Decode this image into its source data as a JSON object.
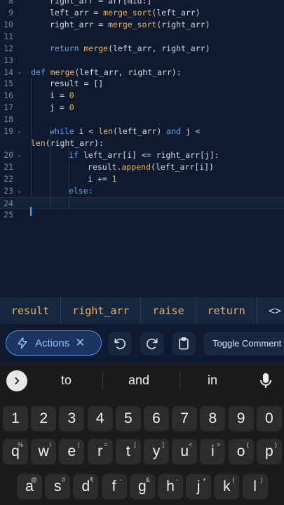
{
  "editor": {
    "lines": [
      {
        "num": "8",
        "indent": 1,
        "fold": false,
        "tokens": [
          {
            "t": "right_arr = arr[mid:]"
          }
        ]
      },
      {
        "num": "9",
        "indent": 1,
        "fold": false,
        "tokens": [
          {
            "t": "left_arr = "
          },
          {
            "t": "merge_sort",
            "c": "fn"
          },
          {
            "t": "(left_arr)"
          }
        ]
      },
      {
        "num": "10",
        "indent": 1,
        "fold": false,
        "tokens": [
          {
            "t": "right_arr = "
          },
          {
            "t": "merge_sort",
            "c": "fn"
          },
          {
            "t": "(right_arr)"
          }
        ]
      },
      {
        "num": "11",
        "indent": 0,
        "fold": false,
        "tokens": []
      },
      {
        "num": "12",
        "indent": 1,
        "fold": false,
        "tokens": [
          {
            "t": "return ",
            "c": "kw"
          },
          {
            "t": "merge",
            "c": "fn"
          },
          {
            "t": "(left_arr, right_arr)"
          }
        ]
      },
      {
        "num": "13",
        "indent": 0,
        "fold": false,
        "tokens": []
      },
      {
        "num": "14",
        "indent": 0,
        "fold": true,
        "tokens": [
          {
            "t": "def ",
            "c": "kw"
          },
          {
            "t": "merge",
            "c": "fn"
          },
          {
            "t": "(left_arr, right_arr):"
          }
        ]
      },
      {
        "num": "15",
        "indent": 1,
        "fold": false,
        "tokens": [
          {
            "t": "result = []"
          }
        ]
      },
      {
        "num": "16",
        "indent": 1,
        "fold": false,
        "tokens": [
          {
            "t": "i = "
          },
          {
            "t": "0",
            "c": "num"
          }
        ]
      },
      {
        "num": "17",
        "indent": 1,
        "fold": false,
        "tokens": [
          {
            "t": "j = "
          },
          {
            "t": "0",
            "c": "num"
          }
        ]
      },
      {
        "num": "18",
        "indent": 0,
        "fold": false,
        "tokens": []
      },
      {
        "num": "19",
        "indent": 1,
        "fold": true,
        "tokens": [
          {
            "t": "while ",
            "c": "kw"
          },
          {
            "t": "i < "
          },
          {
            "t": "len",
            "c": "fn"
          },
          {
            "t": "(left_arr) "
          },
          {
            "t": "and ",
            "c": "kw"
          },
          {
            "t": "j <"
          }
        ]
      },
      {
        "num": "",
        "indent": 0,
        "fold": false,
        "tokens": [
          {
            "t": "len",
            "c": "fn"
          },
          {
            "t": "(right_arr):"
          }
        ]
      },
      {
        "num": "20",
        "indent": 2,
        "fold": true,
        "tokens": [
          {
            "t": "if ",
            "c": "kw"
          },
          {
            "t": "left_arr[i] <= right_arr[j]:"
          }
        ]
      },
      {
        "num": "21",
        "indent": 3,
        "fold": false,
        "tokens": [
          {
            "t": "result."
          },
          {
            "t": "append",
            "c": "fn"
          },
          {
            "t": "(left_arr[i])"
          }
        ]
      },
      {
        "num": "22",
        "indent": 3,
        "fold": false,
        "tokens": [
          {
            "t": "i += "
          },
          {
            "t": "1",
            "c": "num"
          }
        ]
      },
      {
        "num": "23",
        "indent": 2,
        "fold": true,
        "tokens": [
          {
            "t": "else:",
            "c": "kw"
          }
        ]
      },
      {
        "num": "24",
        "indent": 0,
        "fold": false,
        "tokens": [],
        "active": true
      },
      {
        "num": "25",
        "indent": 0,
        "fold": false,
        "tokens": []
      }
    ]
  },
  "suggestions": {
    "items": [
      "result",
      "right_arr",
      "raise",
      "return"
    ],
    "more_icon": "code-icon"
  },
  "toolbar": {
    "actions_label": "Actions",
    "actions_icon": "lightning-icon",
    "toggle_comment_label": "Toggle Comment",
    "undo_icon": "undo-icon",
    "redo_icon": "redo-icon",
    "clipboard_icon": "clipboard-icon"
  },
  "keyboard": {
    "suggestions": [
      "to",
      "and",
      "in"
    ],
    "numbers": [
      "1",
      "2",
      "3",
      "4",
      "5",
      "6",
      "7",
      "8",
      "9",
      "0"
    ],
    "row1": [
      {
        "k": "q",
        "h": "%"
      },
      {
        "k": "w",
        "h": "\\"
      },
      {
        "k": "e",
        "h": "|"
      },
      {
        "k": "r",
        "h": "="
      },
      {
        "k": "t",
        "h": "["
      },
      {
        "k": "y",
        "h": "]"
      },
      {
        "k": "u",
        "h": "<"
      },
      {
        "k": "i",
        "h": ">"
      },
      {
        "k": "o",
        "h": "{"
      },
      {
        "k": "p",
        "h": "}"
      }
    ],
    "row2": [
      {
        "k": "a",
        "h": "@"
      },
      {
        "k": "s",
        "h": "#"
      },
      {
        "k": "d",
        "h": "₹"
      },
      {
        "k": "f",
        "h": "-"
      },
      {
        "k": "g",
        "h": "&"
      },
      {
        "k": "h",
        "h": "-"
      },
      {
        "k": "j",
        "h": "+"
      },
      {
        "k": "k",
        "h": "("
      },
      {
        "k": "l",
        "h": ")"
      }
    ],
    "colors": {
      "key": "#2c2c2e",
      "background": "#1b1b1d"
    }
  },
  "colors": {
    "editor_bg": "#0f1a2e",
    "keyword": "#5aa5f0",
    "function": "#f0b357",
    "accent": "#4d8ff0"
  }
}
